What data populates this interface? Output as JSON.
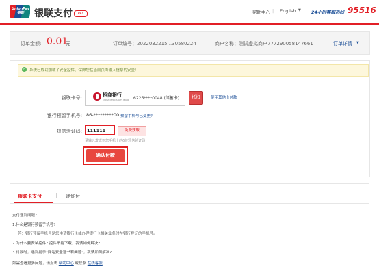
{
  "header": {
    "logo_text": "UnionPay 银联",
    "brand_title": "银联支付",
    "brand_badge": "PAY",
    "help_center": "帮助中心",
    "separator": "|",
    "language": "English",
    "lang_caret": "▼",
    "hotline_label": "24小时客服热线",
    "hotline_number": "95516",
    "accent_color": "#e21f26"
  },
  "order": {
    "amount_label": "订单金额:",
    "amount_value": "0.01",
    "amount_unit": "元",
    "order_no": "订单编号：2022032215...30580224",
    "merchant": "商户名称：测试虚拟商户777290058147661",
    "details_link": "订单详情",
    "details_caret": "▼"
  },
  "notice": {
    "icon": "check-icon",
    "text": "系统已成功加载了安全控件，保障您在当前页面输入信息的安全!"
  },
  "form": {
    "card_label": "银联卡号:",
    "bank_name": "招商银行",
    "bank_name_en": "CHINA MERCHANTS BANK",
    "card_number": "6226****0048 (储蓄卡)",
    "tiqian_badge": "抵扣",
    "other_card_link": "使用其他卡付款",
    "phone_label": "银行预留手机号:",
    "phone_value": "86-*********00",
    "phone_change_link": "预留手机号已变更?",
    "sms_label": "短信验证码:",
    "sms_value": "111111",
    "sms_button": "免费获取",
    "sms_hint": "请输入发送到您手机上的6位短信验证码",
    "pay_button": "确认付款"
  },
  "tabs": {
    "tab1": "银联卡支付",
    "separator": "|",
    "tab2": "迷你付"
  },
  "faq": {
    "title": "支付遇到问题?",
    "q1": "1.什么是银行预留手机号?",
    "a1": "答：银行预留手机号是您申请银行卡或办理银行卡相关业务时在银行登记的手机号。",
    "q2": "2.为什么要安装控件? 控件不能下载，我该如何解决?",
    "q3": "3.付款时，遇到提示\"网站安全证书有问题\"，我该如何解决?",
    "more_prefix": "如需查看更多问题，请点击",
    "help_link": "帮助中心",
    "or_contact": "或联系",
    "service_link": "在线客服"
  }
}
